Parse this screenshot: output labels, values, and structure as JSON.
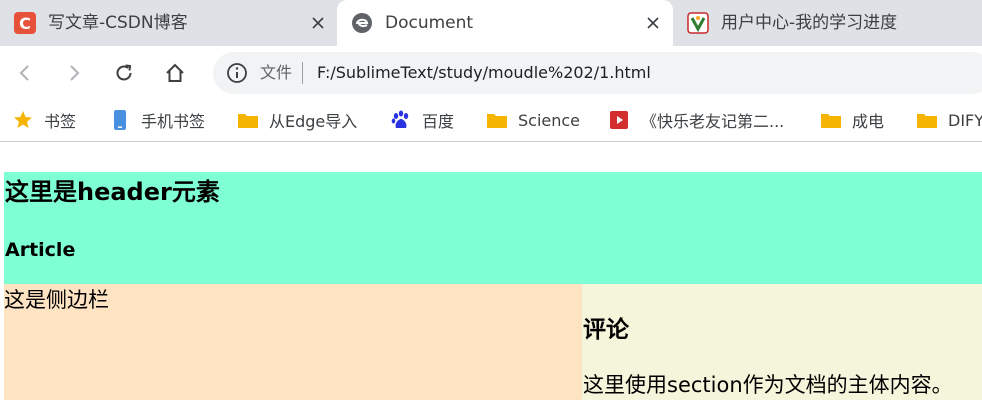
{
  "browser": {
    "tabs": [
      {
        "title": "写文章-CSDN博客",
        "icon": "csdn-icon",
        "active": false
      },
      {
        "title": "Document",
        "icon": "edge-icon",
        "active": true
      },
      {
        "title": "用户中心-我的学习进度",
        "icon": "site-icon",
        "active": false
      }
    ],
    "address_bar": {
      "label": "文件",
      "url": "F:/SublimeText/study/moudle%202/1.html"
    },
    "bookmarks": [
      {
        "label": "书签",
        "icon": "star-icon"
      },
      {
        "label": "手机书签",
        "icon": "phone-icon"
      },
      {
        "label": "从Edge导入",
        "icon": "folder-icon"
      },
      {
        "label": "百度",
        "icon": "baidu-paw-icon"
      },
      {
        "label": "Science",
        "icon": "folder-icon"
      },
      {
        "label": "《快乐老友记第二...",
        "icon": "video-icon"
      },
      {
        "label": "成电",
        "icon": "folder-icon"
      },
      {
        "label": "DIFY",
        "icon": "folder-icon"
      }
    ]
  },
  "page": {
    "header": {
      "title": "这里是header元素",
      "subtitle": "Article"
    },
    "aside": {
      "text": "这是侧边栏"
    },
    "section": {
      "title": "评论",
      "text": "这里使用section作为文档的主体内容。"
    }
  },
  "colors": {
    "header_bg": "#7fffd4",
    "aside_bg": "#ffe4c4",
    "section_bg": "#f5f5dc",
    "tabstrip_bg": "#dee1e6",
    "folder": "#f4b400",
    "csdn": "#e6533a"
  }
}
